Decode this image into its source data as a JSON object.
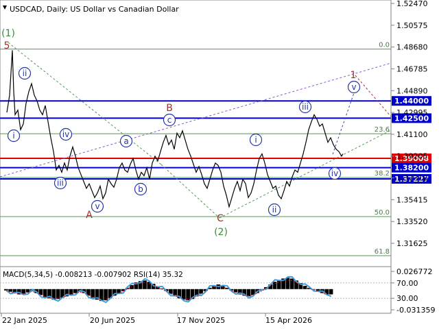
{
  "header": {
    "symbol_label": "USDCAD, Daily:  US Dollar vs Canadian Dollar"
  },
  "colors": {
    "price_line": "#000000",
    "level_blue": "#0000cc",
    "level_red": "#e00000",
    "fib_green": "#4e9a4e",
    "wave_dark_red": "#a03030",
    "wave_blue_circle": "#2233aa",
    "wave_green": "#3a8a3a",
    "channel_purple": "#8855cc",
    "dotted_blue": "#3344cc",
    "macd_hist": "#000000",
    "macd_rsi_line": "#3fa0e0",
    "macd_signal": "#d02020"
  },
  "chart_data": {
    "type": "line",
    "title": "USDCAD, Daily:  US Dollar vs Canadian Dollar",
    "xlabel": "",
    "ylabel": "",
    "ylim": [
      1.3,
      1.525
    ],
    "x_ticks": [
      "22 Jan 2025",
      "20 Jun 2025",
      "17 Nov 2025",
      "15 Apr 2026"
    ],
    "y_ticks": [
      "1.52470",
      "1.50575",
      "1.48680",
      "1.46785",
      "1.44890",
      "1.42995",
      "1.41100",
      "1.39205",
      "1.37310",
      "1.35415",
      "1.33520",
      "1.31625"
    ],
    "price_series": {
      "name": "",
      "points": [
        [
          0,
          1.43
        ],
        [
          4,
          1.445
        ],
        [
          8,
          1.484
        ],
        [
          10,
          1.448
        ],
        [
          12,
          1.428
        ],
        [
          16,
          1.432
        ],
        [
          20,
          1.415
        ],
        [
          24,
          1.42
        ],
        [
          28,
          1.438
        ],
        [
          32,
          1.448
        ],
        [
          36,
          1.455
        ],
        [
          40,
          1.445
        ],
        [
          44,
          1.44
        ],
        [
          48,
          1.432
        ],
        [
          52,
          1.428
        ],
        [
          56,
          1.436
        ],
        [
          60,
          1.422
        ],
        [
          64,
          1.408
        ],
        [
          68,
          1.396
        ],
        [
          72,
          1.38
        ],
        [
          76,
          1.384
        ],
        [
          80,
          1.378
        ],
        [
          84,
          1.386
        ],
        [
          88,
          1.38
        ],
        [
          92,
          1.392
        ],
        [
          96,
          1.4
        ],
        [
          100,
          1.392
        ],
        [
          104,
          1.382
        ],
        [
          108,
          1.376
        ],
        [
          112,
          1.37
        ],
        [
          116,
          1.364
        ],
        [
          120,
          1.368
        ],
        [
          124,
          1.362
        ],
        [
          128,
          1.356
        ],
        [
          132,
          1.36
        ],
        [
          136,
          1.366
        ],
        [
          140,
          1.355
        ],
        [
          144,
          1.36
        ],
        [
          148,
          1.372
        ],
        [
          152,
          1.368
        ],
        [
          156,
          1.365
        ],
        [
          160,
          1.372
        ],
        [
          164,
          1.382
        ],
        [
          168,
          1.386
        ],
        [
          172,
          1.38
        ],
        [
          176,
          1.378
        ],
        [
          180,
          1.385
        ],
        [
          184,
          1.39
        ],
        [
          188,
          1.38
        ],
        [
          192,
          1.372
        ],
        [
          196,
          1.378
        ],
        [
          200,
          1.375
        ],
        [
          204,
          1.382
        ],
        [
          208,
          1.372
        ],
        [
          212,
          1.386
        ],
        [
          216,
          1.392
        ],
        [
          220,
          1.388
        ],
        [
          224,
          1.396
        ],
        [
          228,
          1.404
        ],
        [
          232,
          1.41
        ],
        [
          236,
          1.402
        ],
        [
          240,
          1.406
        ],
        [
          244,
          1.398
        ],
        [
          248,
          1.412
        ],
        [
          252,
          1.408
        ],
        [
          256,
          1.414
        ],
        [
          260,
          1.406
        ],
        [
          264,
          1.398
        ],
        [
          268,
          1.392
        ],
        [
          272,
          1.385
        ],
        [
          276,
          1.378
        ],
        [
          280,
          1.383
        ],
        [
          284,
          1.376
        ],
        [
          288,
          1.368
        ],
        [
          292,
          1.364
        ],
        [
          296,
          1.372
        ],
        [
          300,
          1.38
        ],
        [
          304,
          1.386
        ],
        [
          308,
          1.384
        ],
        [
          312,
          1.378
        ],
        [
          316,
          1.366
        ],
        [
          320,
          1.358
        ],
        [
          324,
          1.348
        ],
        [
          328,
          1.356
        ],
        [
          332,
          1.364
        ],
        [
          336,
          1.37
        ],
        [
          340,
          1.362
        ],
        [
          344,
          1.372
        ],
        [
          348,
          1.368
        ],
        [
          352,
          1.356
        ],
        [
          356,
          1.36
        ],
        [
          360,
          1.368
        ],
        [
          364,
          1.38
        ],
        [
          368,
          1.39
        ],
        [
          372,
          1.394
        ],
        [
          376,
          1.386
        ],
        [
          380,
          1.376
        ],
        [
          384,
          1.37
        ],
        [
          388,
          1.364
        ],
        [
          392,
          1.366
        ],
        [
          396,
          1.358
        ],
        [
          400,
          1.355
        ],
        [
          404,
          1.362
        ],
        [
          408,
          1.37
        ],
        [
          412,
          1.366
        ],
        [
          416,
          1.374
        ],
        [
          420,
          1.38
        ],
        [
          424,
          1.378
        ],
        [
          428,
          1.386
        ],
        [
          432,
          1.394
        ],
        [
          436,
          1.404
        ],
        [
          440,
          1.415
        ],
        [
          444,
          1.422
        ],
        [
          448,
          1.428
        ],
        [
          452,
          1.424
        ],
        [
          456,
          1.418
        ],
        [
          460,
          1.42
        ],
        [
          464,
          1.412
        ],
        [
          468,
          1.404
        ],
        [
          472,
          1.408
        ],
        [
          476,
          1.402
        ],
        [
          480,
          1.398
        ],
        [
          484,
          1.396
        ],
        [
          488,
          1.392
        ],
        [
          490,
          1.394
        ]
      ]
    },
    "horizontal_levels": [
      {
        "label": "1.44000",
        "value": 1.44,
        "kind": "blue"
      },
      {
        "label": "1.42500",
        "value": 1.425,
        "kind": "blue"
      },
      {
        "label": "1.39008",
        "value": 1.39008,
        "kind": "red"
      },
      {
        "label": "1.38200",
        "value": 1.382,
        "kind": "blue"
      },
      {
        "label": "1.37227",
        "value": 1.37227,
        "kind": "blue"
      }
    ],
    "fib_levels": [
      {
        "label": "0.0",
        "value": 1.485
      },
      {
        "label": "23.6",
        "value": 1.4115
      },
      {
        "label": "38.2",
        "value": 1.3735
      },
      {
        "label": "50.0",
        "value": 1.3395
      },
      {
        "label": "61.8",
        "value": 1.3055
      }
    ],
    "wave_labels": [
      {
        "text": "(1)",
        "style": "green"
      },
      {
        "text": "5",
        "style": "darkred"
      },
      {
        "text": "ii",
        "style": "circle"
      },
      {
        "text": "i",
        "style": "circle"
      },
      {
        "text": "iv",
        "style": "circle"
      },
      {
        "text": "iii",
        "style": "circle"
      },
      {
        "text": "v",
        "style": "circle"
      },
      {
        "text": "A",
        "style": "darkred"
      },
      {
        "text": "a",
        "style": "circle"
      },
      {
        "text": "b",
        "style": "circle"
      },
      {
        "text": "c",
        "style": "circle"
      },
      {
        "text": "B",
        "style": "darkred"
      },
      {
        "text": "C",
        "style": "darkred"
      },
      {
        "text": "(2)",
        "style": "green"
      },
      {
        "text": "i",
        "style": "circle"
      },
      {
        "text": "ii",
        "style": "circle"
      },
      {
        "text": "iii",
        "style": "circle"
      },
      {
        "text": "iv",
        "style": "circle"
      },
      {
        "text": "v",
        "style": "circle"
      },
      {
        "text": "1",
        "style": "darkred"
      }
    ],
    "indicator": {
      "label": "MACD(5,34,5) -0.008213 -0.007902 RSI(14) 35.32",
      "y_ticks": [
        "0.026772",
        "70.00",
        "30.00",
        "-0.031359"
      ],
      "macd_histogram": [
        -0.002,
        -0.004,
        -0.006,
        -0.008,
        -0.007,
        -0.005,
        -0.003,
        -0.006,
        -0.009,
        -0.012,
        -0.014,
        -0.016,
        -0.015,
        -0.013,
        -0.011,
        -0.008,
        -0.006,
        -0.004,
        -0.006,
        -0.01,
        -0.013,
        -0.016,
        -0.018,
        -0.017,
        -0.014,
        -0.01,
        -0.006,
        -0.003,
        0.002,
        0.006,
        0.01,
        0.012,
        0.013,
        0.011,
        0.008,
        0.004,
        0.001,
        -0.003,
        -0.007,
        -0.011,
        -0.014,
        -0.016,
        -0.017,
        -0.015,
        -0.011,
        -0.007,
        -0.003,
        0.002,
        0.005,
        0.007,
        0.005,
        0.002,
        -0.002,
        -0.005,
        -0.008,
        -0.01,
        -0.011,
        -0.009,
        -0.006,
        -0.002,
        0.003,
        0.007,
        0.011,
        0.014,
        0.016,
        0.017,
        0.016,
        0.013,
        0.009,
        0.005,
        0.002,
        0.0,
        -0.003,
        -0.006,
        -0.008,
        -0.008
      ]
    }
  }
}
